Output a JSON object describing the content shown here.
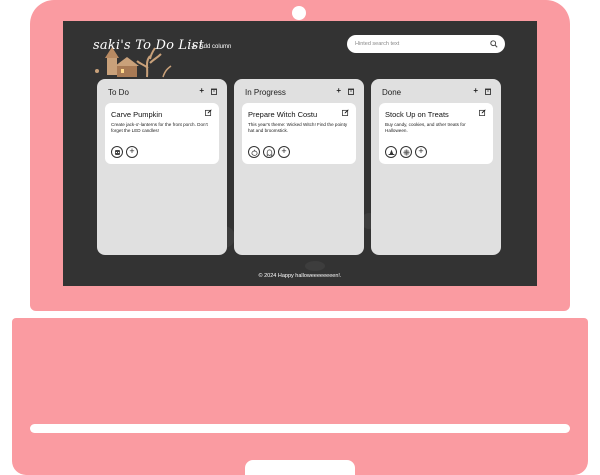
{
  "app": {
    "title": "saki's To Do List",
    "add_column_label": "Add column",
    "search_placeholder": "Hinted search text",
    "footer": "© 2024 Happy halloweeeeeeeen!."
  },
  "columns": [
    {
      "title": "To Do",
      "card": {
        "title": "Carve Pumpkin",
        "description": "Create jack-o'-lanterns for the front porch. Don't forget the LED candles!",
        "icons": [
          "frankenstein-icon",
          "add-icon"
        ]
      }
    },
    {
      "title": "In Progress",
      "card": {
        "title": "Prepare Witch Costu",
        "description": "This year's theme: Wicked Witch! Find the pointy hat and broomstick.",
        "icons": [
          "pumpkin-icon",
          "ghost-icon",
          "add-icon"
        ]
      }
    },
    {
      "title": "Done",
      "card": {
        "title": "Stock Up on Treats",
        "description": "Buy candy, cookies, and other treats for Halloween.",
        "icons": [
          "witch-hat-icon",
          "spider-web-icon",
          "add-icon"
        ]
      }
    }
  ],
  "colors": {
    "laptop": "#fa9ba1",
    "screen": "#333333",
    "column": "#e0e0e0",
    "card": "#ffffff"
  }
}
